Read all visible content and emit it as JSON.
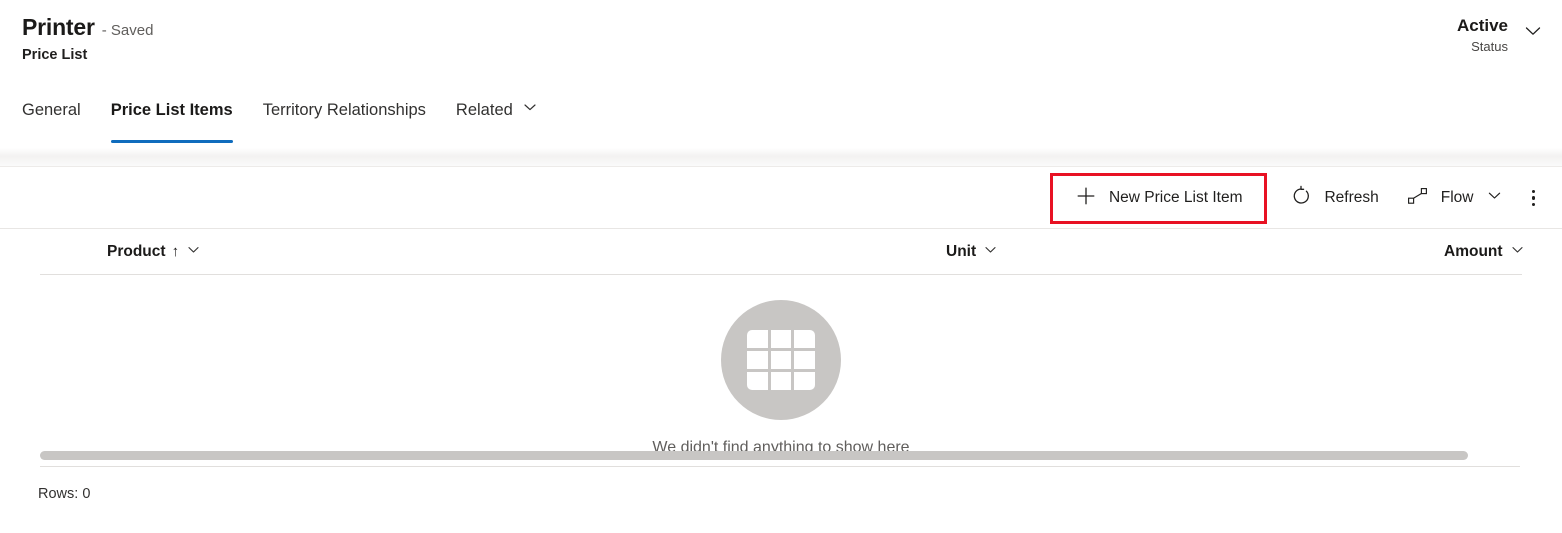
{
  "record": {
    "title": "Printer",
    "saved_state": "- Saved",
    "subtitle": "Price List",
    "status_value": "Active",
    "status_label": "Status",
    "status_chevron_icon": "chevron-down-icon"
  },
  "tabs": [
    {
      "label": "General",
      "active": false,
      "has_chevron": false
    },
    {
      "label": "Price List Items",
      "active": true,
      "has_chevron": false
    },
    {
      "label": "Territory Relationships",
      "active": false,
      "has_chevron": false
    },
    {
      "label": "Related",
      "active": false,
      "has_chevron": true
    }
  ],
  "command_bar": {
    "new_item": {
      "label": "New Price List Item",
      "icon": "plus-icon",
      "highlighted": true
    },
    "refresh": {
      "label": "Refresh",
      "icon": "refresh-icon"
    },
    "flow": {
      "label": "Flow",
      "icon": "flow-icon",
      "chevron_icon": "chevron-down-icon"
    },
    "overflow": {
      "icon": "more-vertical-icon"
    }
  },
  "grid": {
    "columns": [
      {
        "label": "Product",
        "sort_indicator": "↑",
        "chevron_icon": "chevron-down-icon"
      },
      {
        "label": "Unit",
        "sort_indicator": "",
        "chevron_icon": "chevron-down-icon"
      },
      {
        "label": "Amount",
        "sort_indicator": "",
        "chevron_icon": "chevron-down-icon"
      }
    ],
    "rows": [],
    "empty_message": "We didn't find anything to show here",
    "empty_icon": "table-grid-icon",
    "rows_count_label": "Rows: 0"
  },
  "colors": {
    "accent_blue": "#0f6cbd",
    "highlight_red": "#e81123",
    "empty_circle_gray": "#c8c6c4"
  }
}
